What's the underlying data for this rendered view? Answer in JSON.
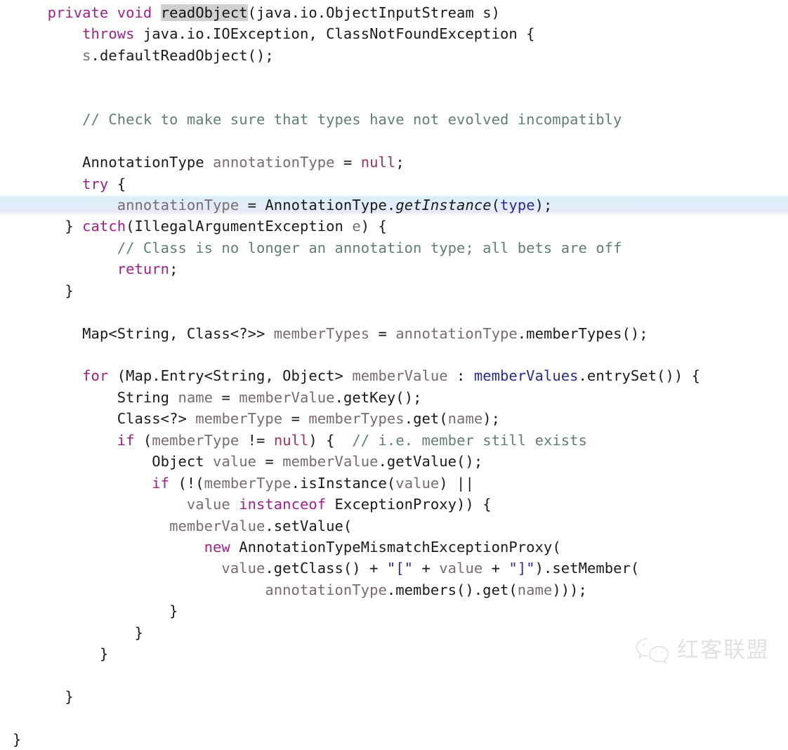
{
  "document": {
    "kind": "source-code-screenshot",
    "language": "Java",
    "background_color": "#ffffff"
  },
  "theme": {
    "plain": "#1a1a1a",
    "keyword": "#a0208a",
    "literal": "#99335b",
    "comment": "#5f7f6f",
    "field": "#2a2a8c",
    "string": "#2a2a8c",
    "local_variable": "#7a6a72",
    "selection_background": "#d0d0d0",
    "highlight_line_background": "#e2eefb"
  },
  "code": {
    "lines": [
      {
        "number": 1,
        "highlighted": false,
        "text": "private void readObject(java.io.ObjectInputStream s)",
        "tokens": [
          {
            "t": "    ",
            "c": "plain"
          },
          {
            "t": "private",
            "c": "keyword"
          },
          {
            "t": " ",
            "c": "plain"
          },
          {
            "t": "void",
            "c": "keyword"
          },
          {
            "t": " ",
            "c": "plain"
          },
          {
            "t": "readObject",
            "c": "selected"
          },
          {
            "t": "(java.io.ObjectInputStream s)",
            "c": "plain"
          }
        ]
      },
      {
        "number": 2,
        "highlighted": false,
        "text": "    throws java.io.IOException, ClassNotFoundException {",
        "tokens": [
          {
            "t": "        ",
            "c": "plain"
          },
          {
            "t": "throws",
            "c": "keyword"
          },
          {
            "t": " java.io.IOException, ClassNotFoundException {",
            "c": "plain"
          }
        ]
      },
      {
        "number": 3,
        "highlighted": false,
        "text": "    s.defaultReadObject();",
        "tokens": [
          {
            "t": "        ",
            "c": "plain"
          },
          {
            "t": "s",
            "c": "local"
          },
          {
            "t": ".defaultReadObject();",
            "c": "plain"
          }
        ]
      },
      {
        "number": 4,
        "highlighted": false,
        "text": "",
        "tokens": []
      },
      {
        "number": 5,
        "highlighted": false,
        "text": "",
        "tokens": []
      },
      {
        "number": 6,
        "highlighted": false,
        "text": "    // Check to make sure that types have not evolved incompatibly",
        "tokens": [
          {
            "t": "        ",
            "c": "plain"
          },
          {
            "t": "// Check to make sure that types have not evolved incompatibly",
            "c": "comment"
          }
        ]
      },
      {
        "number": 7,
        "highlighted": false,
        "text": "",
        "tokens": []
      },
      {
        "number": 8,
        "highlighted": false,
        "text": "    AnnotationType annotationType = null;",
        "tokens": [
          {
            "t": "        ",
            "c": "plain"
          },
          {
            "t": "AnnotationType",
            "c": "type"
          },
          {
            "t": " ",
            "c": "plain"
          },
          {
            "t": "annotationType",
            "c": "local"
          },
          {
            "t": " = ",
            "c": "plain"
          },
          {
            "t": "null",
            "c": "literal"
          },
          {
            "t": ";",
            "c": "plain"
          }
        ]
      },
      {
        "number": 9,
        "highlighted": false,
        "text": "    try {",
        "tokens": [
          {
            "t": "        ",
            "c": "plain"
          },
          {
            "t": "try",
            "c": "keyword"
          },
          {
            "t": " {",
            "c": "plain"
          }
        ]
      },
      {
        "number": 10,
        "highlighted": true,
        "text": "        annotationType = AnnotationType.getInstance(type);",
        "tokens": [
          {
            "t": "            ",
            "c": "plain"
          },
          {
            "t": "annotationType",
            "c": "local"
          },
          {
            "t": " = ",
            "c": "plain"
          },
          {
            "t": "AnnotationType",
            "c": "type"
          },
          {
            "t": ".",
            "c": "plain"
          },
          {
            "t": "getInstance",
            "c": "method-italic"
          },
          {
            "t": "(",
            "c": "plain"
          },
          {
            "t": "type",
            "c": "field"
          },
          {
            "t": ");",
            "c": "plain"
          }
        ]
      },
      {
        "number": 11,
        "highlighted": false,
        "text": "    } catch(IllegalArgumentException e) {",
        "tokens": [
          {
            "t": "      } ",
            "c": "plain"
          },
          {
            "t": "catch",
            "c": "keyword"
          },
          {
            "t": "(IllegalArgumentException ",
            "c": "plain"
          },
          {
            "t": "e",
            "c": "local"
          },
          {
            "t": ") {",
            "c": "plain"
          }
        ]
      },
      {
        "number": 12,
        "highlighted": false,
        "text": "        // Class is no longer an annotation type; all bets are off",
        "tokens": [
          {
            "t": "            ",
            "c": "plain"
          },
          {
            "t": "// Class is no longer an annotation type; all bets are off",
            "c": "comment"
          }
        ]
      },
      {
        "number": 13,
        "highlighted": false,
        "text": "        return;",
        "tokens": [
          {
            "t": "            ",
            "c": "plain"
          },
          {
            "t": "return",
            "c": "keyword"
          },
          {
            "t": ";",
            "c": "plain"
          }
        ]
      },
      {
        "number": 14,
        "highlighted": false,
        "text": "    }",
        "tokens": [
          {
            "t": "      }",
            "c": "plain"
          }
        ]
      },
      {
        "number": 15,
        "highlighted": false,
        "text": "",
        "tokens": []
      },
      {
        "number": 16,
        "highlighted": false,
        "text": "    Map<String, Class<?>> memberTypes = annotationType.memberTypes();",
        "tokens": [
          {
            "t": "        ",
            "c": "plain"
          },
          {
            "t": "Map<String, Class<?>>",
            "c": "type"
          },
          {
            "t": " ",
            "c": "plain"
          },
          {
            "t": "memberTypes",
            "c": "local"
          },
          {
            "t": " = ",
            "c": "plain"
          },
          {
            "t": "annotationType",
            "c": "local"
          },
          {
            "t": ".memberTypes();",
            "c": "plain"
          }
        ]
      },
      {
        "number": 17,
        "highlighted": false,
        "text": "",
        "tokens": []
      },
      {
        "number": 18,
        "highlighted": false,
        "text": "    for (Map.Entry<String, Object> memberValue : memberValues.entrySet()) {",
        "tokens": [
          {
            "t": "        ",
            "c": "plain"
          },
          {
            "t": "for",
            "c": "keyword"
          },
          {
            "t": " (Map.Entry<String, Object> ",
            "c": "plain"
          },
          {
            "t": "memberValue",
            "c": "local"
          },
          {
            "t": " : ",
            "c": "plain"
          },
          {
            "t": "memberValues",
            "c": "field"
          },
          {
            "t": ".entrySet()) {",
            "c": "plain"
          }
        ]
      },
      {
        "number": 19,
        "highlighted": false,
        "text": "        String name = memberValue.getKey();",
        "tokens": [
          {
            "t": "            ",
            "c": "plain"
          },
          {
            "t": "String",
            "c": "type"
          },
          {
            "t": " ",
            "c": "plain"
          },
          {
            "t": "name",
            "c": "local"
          },
          {
            "t": " = ",
            "c": "plain"
          },
          {
            "t": "memberValue",
            "c": "local"
          },
          {
            "t": ".getKey();",
            "c": "plain"
          }
        ]
      },
      {
        "number": 20,
        "highlighted": false,
        "text": "        Class<?> memberType = memberTypes.get(name);",
        "tokens": [
          {
            "t": "            ",
            "c": "plain"
          },
          {
            "t": "Class<?>",
            "c": "type"
          },
          {
            "t": " ",
            "c": "plain"
          },
          {
            "t": "memberType",
            "c": "local"
          },
          {
            "t": " = ",
            "c": "plain"
          },
          {
            "t": "memberTypes",
            "c": "local"
          },
          {
            "t": ".get(",
            "c": "plain"
          },
          {
            "t": "name",
            "c": "local"
          },
          {
            "t": ");",
            "c": "plain"
          }
        ]
      },
      {
        "number": 21,
        "highlighted": false,
        "text": "        if (memberType != null) {  // i.e. member still exists",
        "tokens": [
          {
            "t": "            ",
            "c": "plain"
          },
          {
            "t": "if",
            "c": "keyword"
          },
          {
            "t": " (",
            "c": "plain"
          },
          {
            "t": "memberType",
            "c": "local"
          },
          {
            "t": " != ",
            "c": "plain"
          },
          {
            "t": "null",
            "c": "literal"
          },
          {
            "t": ") {  ",
            "c": "plain"
          },
          {
            "t": "// i.e. member still exists",
            "c": "comment"
          }
        ]
      },
      {
        "number": 22,
        "highlighted": false,
        "text": "            Object value = memberValue.getValue();",
        "tokens": [
          {
            "t": "                ",
            "c": "plain"
          },
          {
            "t": "Object",
            "c": "type"
          },
          {
            "t": " ",
            "c": "plain"
          },
          {
            "t": "value",
            "c": "local"
          },
          {
            "t": " = ",
            "c": "plain"
          },
          {
            "t": "memberValue",
            "c": "local"
          },
          {
            "t": ".getValue();",
            "c": "plain"
          }
        ]
      },
      {
        "number": 23,
        "highlighted": false,
        "text": "            if (!(memberType.isInstance(value) ||",
        "tokens": [
          {
            "t": "                ",
            "c": "plain"
          },
          {
            "t": "if",
            "c": "keyword"
          },
          {
            "t": " (!(",
            "c": "plain"
          },
          {
            "t": "memberType",
            "c": "local"
          },
          {
            "t": ".isInstance(",
            "c": "plain"
          },
          {
            "t": "value",
            "c": "local"
          },
          {
            "t": ") ||",
            "c": "plain"
          }
        ]
      },
      {
        "number": 24,
        "highlighted": false,
        "text": "                value instanceof ExceptionProxy)) {",
        "tokens": [
          {
            "t": "                    ",
            "c": "plain"
          },
          {
            "t": "value",
            "c": "local"
          },
          {
            "t": " ",
            "c": "plain"
          },
          {
            "t": "instanceof",
            "c": "keyword"
          },
          {
            "t": " ExceptionProxy)) {",
            "c": "plain"
          }
        ]
      },
      {
        "number": 25,
        "highlighted": false,
        "text": "                memberValue.setValue(",
        "tokens": [
          {
            "t": "                  ",
            "c": "plain"
          },
          {
            "t": "memberValue",
            "c": "local"
          },
          {
            "t": ".setValue(",
            "c": "plain"
          }
        ]
      },
      {
        "number": 26,
        "highlighted": false,
        "text": "                    new AnnotationTypeMismatchExceptionProxy(",
        "tokens": [
          {
            "t": "                      ",
            "c": "plain"
          },
          {
            "t": "new",
            "c": "keyword"
          },
          {
            "t": " AnnotationTypeMismatchExceptionProxy(",
            "c": "plain"
          }
        ]
      },
      {
        "number": 27,
        "highlighted": false,
        "text": "                        value.getClass() + \"[\" + value + \"]\").setMember(",
        "tokens": [
          {
            "t": "                        ",
            "c": "plain"
          },
          {
            "t": "value",
            "c": "local"
          },
          {
            "t": ".getClass() + ",
            "c": "plain"
          },
          {
            "t": "\"[\"",
            "c": "string"
          },
          {
            "t": " + ",
            "c": "plain"
          },
          {
            "t": "value",
            "c": "local"
          },
          {
            "t": " + ",
            "c": "plain"
          },
          {
            "t": "\"]\"",
            "c": "string"
          },
          {
            "t": ").setMember(",
            "c": "plain"
          }
        ]
      },
      {
        "number": 28,
        "highlighted": false,
        "text": "                            annotationType.members().get(name)));",
        "tokens": [
          {
            "t": "                             ",
            "c": "plain"
          },
          {
            "t": "annotationType",
            "c": "local"
          },
          {
            "t": ".members().get(",
            "c": "plain"
          },
          {
            "t": "name",
            "c": "local"
          },
          {
            "t": ")));",
            "c": "plain"
          }
        ]
      },
      {
        "number": 29,
        "highlighted": false,
        "text": "            }",
        "tokens": [
          {
            "t": "                  }",
            "c": "plain"
          }
        ]
      },
      {
        "number": 30,
        "highlighted": false,
        "text": "        }",
        "tokens": [
          {
            "t": "              }",
            "c": "plain"
          }
        ]
      },
      {
        "number": 31,
        "highlighted": false,
        "text": "    }",
        "tokens": [
          {
            "t": "          }",
            "c": "plain"
          }
        ]
      },
      {
        "number": 32,
        "highlighted": false,
        "text": "",
        "tokens": []
      },
      {
        "number": 33,
        "highlighted": false,
        "text": "}",
        "tokens": [
          {
            "t": "      }",
            "c": "plain"
          }
        ]
      },
      {
        "number": 34,
        "highlighted": false,
        "text": "",
        "tokens": []
      },
      {
        "number": 35,
        "highlighted": false,
        "text": "}",
        "tokens": [
          {
            "t": "}",
            "c": "plain"
          }
        ]
      }
    ]
  },
  "watermark": {
    "logo_icon": "wechat-logo-icon",
    "text": "红客联盟"
  }
}
